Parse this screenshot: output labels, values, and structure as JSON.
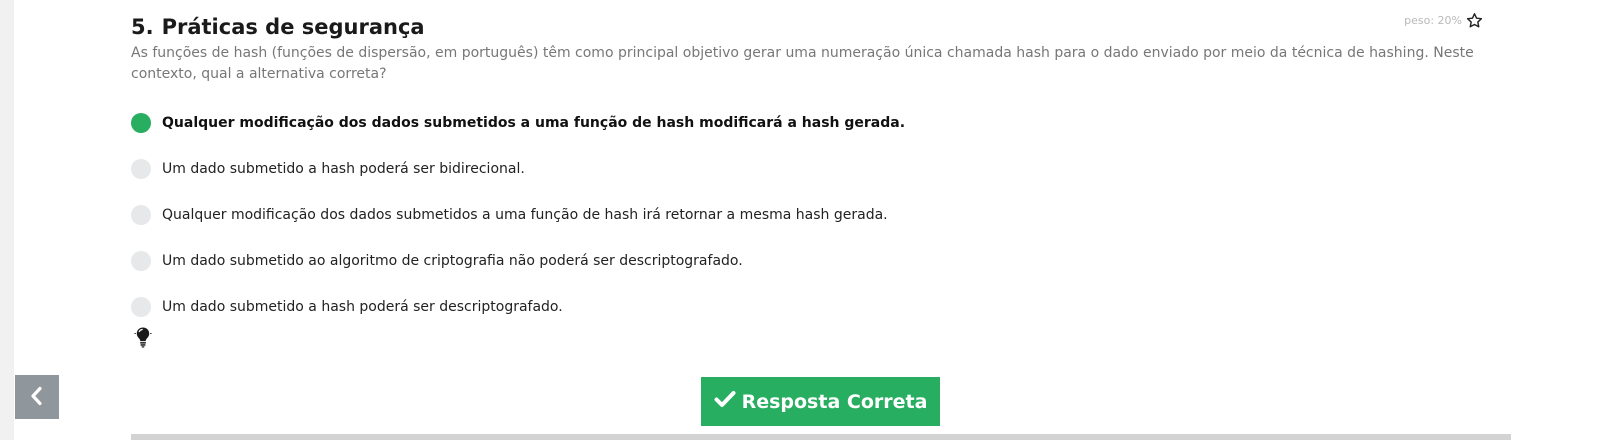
{
  "question": {
    "number": "5.",
    "title": "Práticas de segurança",
    "weight_label": "peso: 20%",
    "statement": "As funções de hash (funções de dispersão, em português) têm como principal objetivo gerar uma numeração única chamada hash para o dado enviado por meio da técnica de hashing. Neste contexto, qual a alternativa correta?",
    "options": [
      {
        "label": "Qualquer modificação dos dados submetidos a uma função de hash modificará a hash gerada.",
        "selected": true
      },
      {
        "label": "Um dado submetido a hash poderá ser bidirecional.",
        "selected": false
      },
      {
        "label": "Qualquer modificação dos dados submetidos a uma função de hash irá retornar a mesma hash gerada.",
        "selected": false
      },
      {
        "label": "Um dado submetido ao algoritmo de criptografia não poderá ser descriptografado.",
        "selected": false
      },
      {
        "label": "Um dado submetido a hash poderá ser descriptografado.",
        "selected": false
      }
    ]
  },
  "actions": {
    "answer_label": "Resposta Correta"
  },
  "icons": {
    "weight": "star-icon",
    "hint": "lightbulb-icon",
    "back": "chevron-left-icon",
    "answer": "check-icon"
  },
  "colors": {
    "accent": "#27ae60",
    "back_button": "#8f969c",
    "radio_unselected": "#e6e8ea",
    "statement_text": "#777777",
    "weight_text": "#b9b9b9"
  }
}
